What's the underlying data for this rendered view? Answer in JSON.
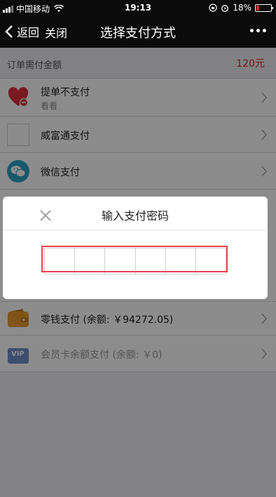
{
  "status_bar": {
    "carrier": "中国移动",
    "time": "19:13",
    "battery": "18%"
  },
  "nav": {
    "back_label": "返回",
    "close_label": "关闭",
    "title": "选择支付方式"
  },
  "summary": {
    "label": "订单需付金额",
    "amount": "120元"
  },
  "payment_options": [
    {
      "title": "提单不支付",
      "subtitle": "看看"
    },
    {
      "title": "威富通支付"
    },
    {
      "title": "微信支付"
    },
    {
      "title": "零钱支付 (余额: ￥94272.05)"
    },
    {
      "title": "会员卡余额支付 (余额: ￥0)"
    }
  ],
  "modal": {
    "title": "输入支付密码"
  },
  "icons": {
    "vip_text": "VIP"
  },
  "colors": {
    "accent_red": "#e02424",
    "highlight_red": "#e8434c",
    "wechat_teal": "#2aa3c4"
  }
}
